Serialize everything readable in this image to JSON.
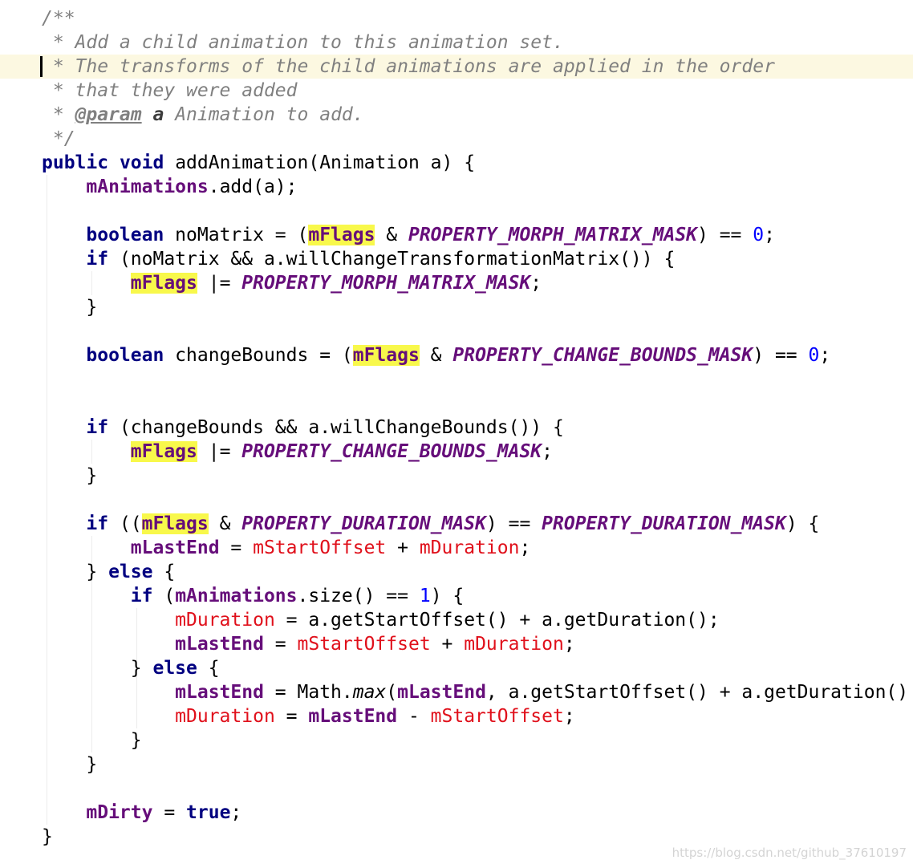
{
  "editor": {
    "language": "Java",
    "current_line_index": 2,
    "lines": [
      [
        {
          "t": "/**",
          "c": "comment"
        }
      ],
      [
        {
          "t": " * Add a child animation to this animation set.",
          "c": "comment"
        }
      ],
      [
        {
          "t": " * The transforms of the child animations are applied in the order",
          "c": "comment"
        }
      ],
      [
        {
          "t": " * that they were added",
          "c": "comment"
        }
      ],
      [
        {
          "t": " * ",
          "c": "comment"
        },
        {
          "t": "@param",
          "c": "doctag"
        },
        {
          "t": " ",
          "c": "comment"
        },
        {
          "t": "a",
          "c": "docparam"
        },
        {
          "t": " Animation to add.",
          "c": "comment"
        }
      ],
      [
        {
          "t": " */",
          "c": "comment"
        }
      ],
      [
        {
          "t": "public",
          "c": "kw"
        },
        {
          "t": " "
        },
        {
          "t": "void",
          "c": "kw"
        },
        {
          "t": " addAnimation(Animation a) {"
        }
      ],
      [
        {
          "t": "    "
        },
        {
          "t": "mAnimations",
          "c": "field"
        },
        {
          "t": ".add(a);"
        }
      ],
      [],
      [
        {
          "t": "    "
        },
        {
          "t": "boolean",
          "c": "kw"
        },
        {
          "t": " noMatrix = ("
        },
        {
          "t": "mFlags",
          "c": "field hl"
        },
        {
          "t": " & "
        },
        {
          "t": "PROPERTY_MORPH_MATRIX_MASK",
          "c": "const"
        },
        {
          "t": ") == "
        },
        {
          "t": "0",
          "c": "num"
        },
        {
          "t": ";"
        }
      ],
      [
        {
          "t": "    "
        },
        {
          "t": "if",
          "c": "kw"
        },
        {
          "t": " (noMatrix && a.willChangeTransformationMatrix()) {"
        }
      ],
      [
        {
          "t": "        "
        },
        {
          "t": "mFlags",
          "c": "field hl"
        },
        {
          "t": " |= "
        },
        {
          "t": "PROPERTY_MORPH_MATRIX_MASK",
          "c": "const"
        },
        {
          "t": ";"
        }
      ],
      [
        {
          "t": "    }"
        }
      ],
      [],
      [
        {
          "t": "    "
        },
        {
          "t": "boolean",
          "c": "kw"
        },
        {
          "t": " changeBounds = ("
        },
        {
          "t": "mFlags",
          "c": "field hl"
        },
        {
          "t": " & "
        },
        {
          "t": "PROPERTY_CHANGE_BOUNDS_MASK",
          "c": "const"
        },
        {
          "t": ") == "
        },
        {
          "t": "0",
          "c": "num"
        },
        {
          "t": ";"
        }
      ],
      [],
      [],
      [
        {
          "t": "    "
        },
        {
          "t": "if",
          "c": "kw"
        },
        {
          "t": " (changeBounds && a.willChangeBounds()) {"
        }
      ],
      [
        {
          "t": "        "
        },
        {
          "t": "mFlags",
          "c": "field hl"
        },
        {
          "t": " |= "
        },
        {
          "t": "PROPERTY_CHANGE_BOUNDS_MASK",
          "c": "const"
        },
        {
          "t": ";"
        }
      ],
      [
        {
          "t": "    }"
        }
      ],
      [],
      [
        {
          "t": "    "
        },
        {
          "t": "if",
          "c": "kw"
        },
        {
          "t": " (("
        },
        {
          "t": "mFlags",
          "c": "field hl"
        },
        {
          "t": " & "
        },
        {
          "t": "PROPERTY_DURATION_MASK",
          "c": "const"
        },
        {
          "t": ") == "
        },
        {
          "t": "PROPERTY_DURATION_MASK",
          "c": "const"
        },
        {
          "t": ") {"
        }
      ],
      [
        {
          "t": "        "
        },
        {
          "t": "mLastEnd",
          "c": "field"
        },
        {
          "t": " = "
        },
        {
          "t": "mStartOffset",
          "c": "red"
        },
        {
          "t": " + "
        },
        {
          "t": "mDuration",
          "c": "red"
        },
        {
          "t": ";"
        }
      ],
      [
        {
          "t": "    } "
        },
        {
          "t": "else",
          "c": "kw"
        },
        {
          "t": " {"
        }
      ],
      [
        {
          "t": "        "
        },
        {
          "t": "if",
          "c": "kw"
        },
        {
          "t": " ("
        },
        {
          "t": "mAnimations",
          "c": "field"
        },
        {
          "t": ".size() == "
        },
        {
          "t": "1",
          "c": "num"
        },
        {
          "t": ") {"
        }
      ],
      [
        {
          "t": "            "
        },
        {
          "t": "mDuration",
          "c": "red"
        },
        {
          "t": " = a.getStartOffset() + a.getDuration();"
        }
      ],
      [
        {
          "t": "            "
        },
        {
          "t": "mLastEnd",
          "c": "field"
        },
        {
          "t": " = "
        },
        {
          "t": "mStartOffset",
          "c": "red"
        },
        {
          "t": " + "
        },
        {
          "t": "mDuration",
          "c": "red"
        },
        {
          "t": ";"
        }
      ],
      [
        {
          "t": "        } "
        },
        {
          "t": "else",
          "c": "kw"
        },
        {
          "t": " {"
        }
      ],
      [
        {
          "t": "            "
        },
        {
          "t": "mLastEnd",
          "c": "field"
        },
        {
          "t": " = Math."
        },
        {
          "t": "max",
          "c": "static"
        },
        {
          "t": "("
        },
        {
          "t": "mLastEnd",
          "c": "field"
        },
        {
          "t": ", a.getStartOffset() + a.getDuration()"
        }
      ],
      [
        {
          "t": "            "
        },
        {
          "t": "mDuration",
          "c": "red"
        },
        {
          "t": " = "
        },
        {
          "t": "mLastEnd",
          "c": "field"
        },
        {
          "t": " - "
        },
        {
          "t": "mStartOffset",
          "c": "red"
        },
        {
          "t": ";"
        }
      ],
      [
        {
          "t": "        }"
        }
      ],
      [
        {
          "t": "    }"
        }
      ],
      [],
      [
        {
          "t": "    "
        },
        {
          "t": "mDirty",
          "c": "field"
        },
        {
          "t": " = "
        },
        {
          "t": "true",
          "c": "kw"
        },
        {
          "t": ";"
        }
      ],
      [
        {
          "t": "}"
        }
      ]
    ]
  },
  "watermark": "https://blog.csdn.net/github_37610197"
}
